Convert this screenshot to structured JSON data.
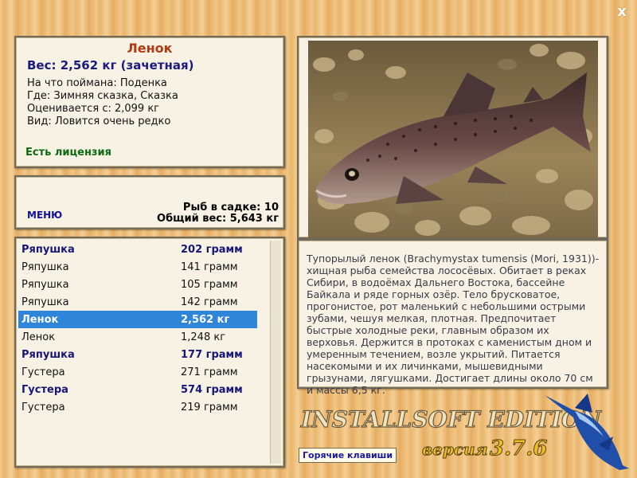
{
  "window": {
    "close_label": "x"
  },
  "info": {
    "title": "Ленок",
    "weight": "Вес: 2,562 кг (зачетная)",
    "caught_on": "На что поймана: Поденка",
    "place": "Где: Зимняя сказка, Сказка",
    "valued_from": "Оценивается с: 2,099 кг",
    "kind": "Вид: Ловится очень редко",
    "license": "Есть лицензия"
  },
  "menu": {
    "menu_label": "МЕНЮ",
    "cage_count": "Рыб в садке: 10",
    "total_weight": "Общий вес: 5,643 кг"
  },
  "catch_list": [
    {
      "name": "Ряпушка",
      "weight": "202 грамм",
      "style": "bold"
    },
    {
      "name": "Ряпушка",
      "weight": "141 грамм",
      "style": "normal"
    },
    {
      "name": "Ряпушка",
      "weight": "105 грамм",
      "style": "normal"
    },
    {
      "name": "Ряпушка",
      "weight": "142 грамм",
      "style": "normal"
    },
    {
      "name": "Ленок",
      "weight": "2,562 кг",
      "style": "selected"
    },
    {
      "name": "Ленок",
      "weight": "1,248 кг",
      "style": "normal"
    },
    {
      "name": "Ряпушка",
      "weight": "177 грамм",
      "style": "bold"
    },
    {
      "name": "Густера",
      "weight": "271 грамм",
      "style": "normal"
    },
    {
      "name": "Густера",
      "weight": "574 грамм",
      "style": "bold"
    },
    {
      "name": "Густера",
      "weight": "219 грамм",
      "style": "normal"
    }
  ],
  "description": "Тупорылый ленок (Brachymystax tumensis (Mori, 1931))- хищная рыба семейства лососёвых. Обитает в реках Сибири, в водоёмах Дальнего Востока, бассейне Байкала и ряде горных озёр. Тело брусковатое, прогонистое, рот маленький с небольшими острыми зубами, чешуя мелкая, плотная. Предпочитает быстрые холодные реки, главным образом их верховья. Держится в протоках с каменистым дном и умеренным течением, возле укрытий. Питается насекомыми и их личинками, мышевидными грызунами, лягушками. Достигает длины около 70 см и массы 6,5 кг.",
  "branding": {
    "product": "INSTALLSOFT EDITION",
    "version_label": "версия",
    "version_number": "3.7.6"
  },
  "hotkeys_label": "Горячие клавиши",
  "colors": {
    "title": "#b03a12",
    "weight": "#1a1a80",
    "license": "#0c6a12",
    "selected_row": "#2f86d8",
    "bold_row": "#16167a"
  }
}
